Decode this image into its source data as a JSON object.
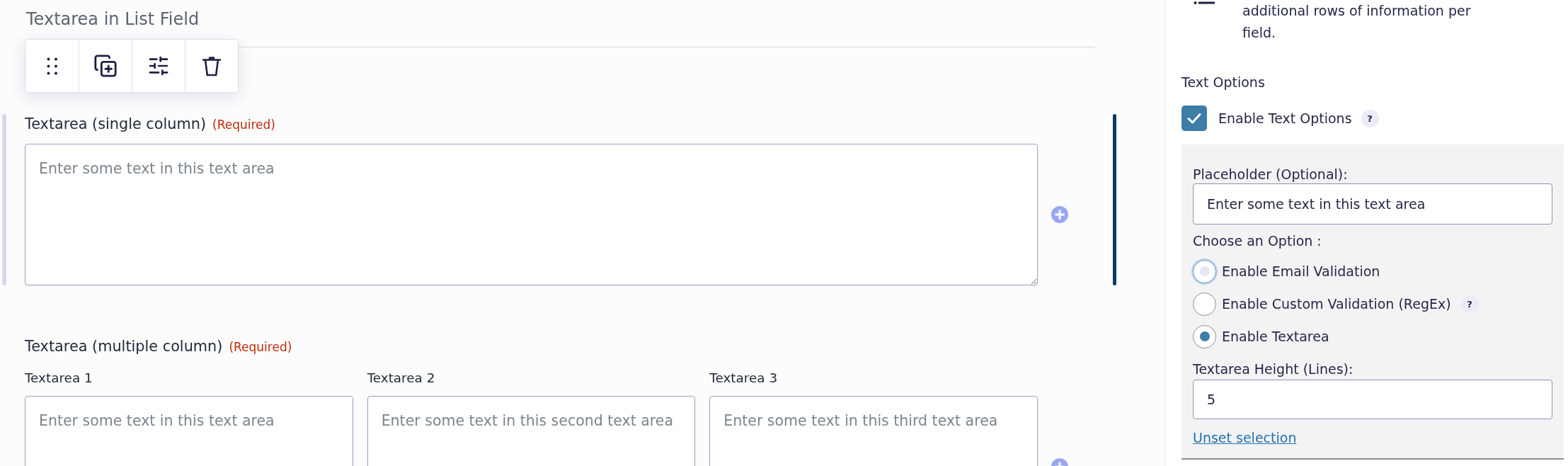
{
  "form": {
    "title": "Textarea in List Field",
    "fields": [
      {
        "label": "Textarea (single column)",
        "required": "(Required)",
        "selected": true,
        "columns": [
          {
            "placeholder": "Enter some text in this text area"
          }
        ]
      },
      {
        "label": "Textarea (multiple column)",
        "required": "(Required)",
        "selected": false,
        "columns": [
          {
            "label": "Textarea 1",
            "placeholder": "Enter some text in this text area"
          },
          {
            "label": "Textarea 2",
            "placeholder": "Enter some text in this second text area"
          },
          {
            "label": "Textarea 3",
            "placeholder": "Enter some text in this third text area"
          }
        ]
      }
    ]
  },
  "settings_panel": {
    "description": "additional rows of information per field.",
    "section_title": "Text Options",
    "enable_text_options": {
      "label": "Enable Text Options",
      "checked": true,
      "help": "?"
    },
    "options": {
      "placeholder_setting": {
        "label": "Placeholder (Optional):",
        "value": "Enter some text in this text area"
      },
      "choice_label": "Choose an Option :",
      "choices": [
        {
          "label": "Enable Email Validation",
          "selected": false,
          "focused": true
        },
        {
          "label": "Enable Custom Validation (RegEx)",
          "selected": false,
          "focused": false,
          "help": "?"
        },
        {
          "label": "Enable Textarea",
          "selected": true,
          "focused": false
        }
      ],
      "height_setting": {
        "label": "Textarea Height (Lines):",
        "value": "5"
      },
      "unset_link": "Unset selection"
    }
  }
}
